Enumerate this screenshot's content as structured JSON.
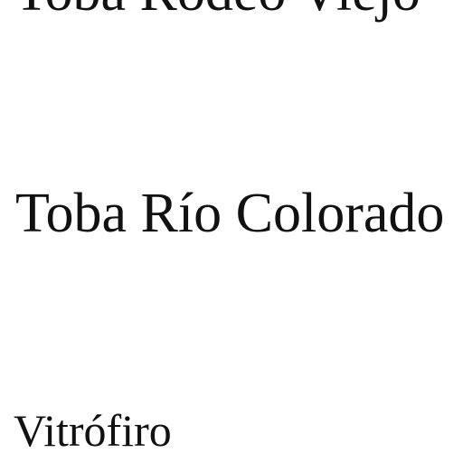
{
  "labels": [
    {
      "text": "Toba Rodeo Viejo"
    },
    {
      "text": "Toba Río Colorado"
    },
    {
      "text": "Vitrófiro"
    }
  ]
}
